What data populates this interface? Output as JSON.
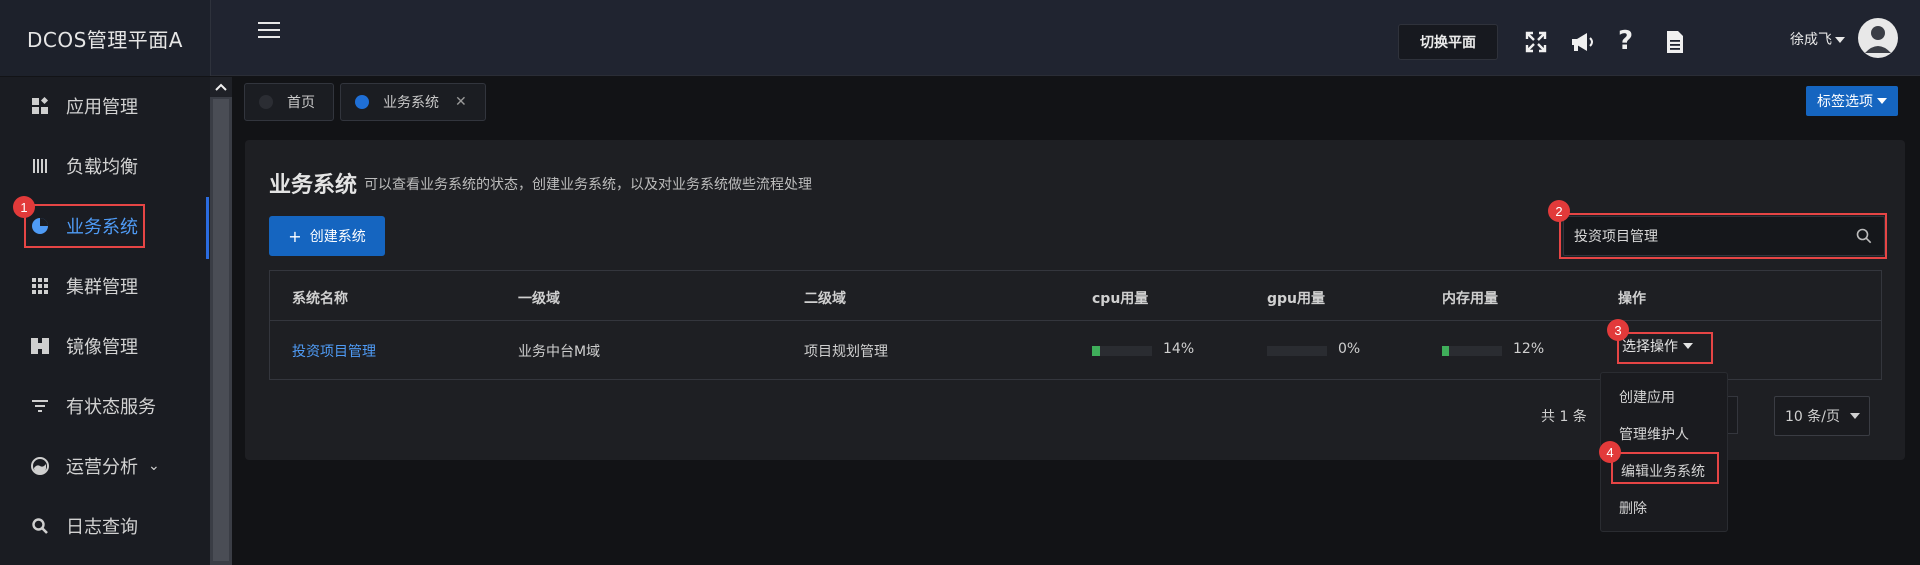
{
  "app": {
    "title": "DCOS管理平面A"
  },
  "header": {
    "switch_plane_label": "切换平面",
    "user_name": "徐成飞",
    "icons": [
      "fullscreen-icon",
      "announcement-icon",
      "help-icon",
      "document-icon"
    ]
  },
  "sidebar": {
    "items": [
      {
        "label": "应用管理",
        "icon": "app-grid-icon"
      },
      {
        "label": "负载均衡",
        "icon": "bars-icon"
      },
      {
        "label": "业务系统",
        "icon": "pie-chart-icon",
        "active": true
      },
      {
        "label": "集群管理",
        "icon": "grid-icon"
      },
      {
        "label": "镜像管理",
        "icon": "image-icon"
      },
      {
        "label": "有状态服务",
        "icon": "filter-icon"
      },
      {
        "label": "运营分析",
        "icon": "gauge-icon"
      },
      {
        "label": "日志查询",
        "icon": "search-icon"
      }
    ]
  },
  "tabs": [
    {
      "label": "首页",
      "dot_color": "#2b2d33"
    },
    {
      "label": "业务系统",
      "dot_color": "#1f6fd6",
      "closable": true
    }
  ],
  "tag_options_label": "标签选项",
  "page": {
    "title": "业务系统",
    "description": "可以查看业务系统的状态，创建业务系统，以及对业务系统做些流程处理",
    "create_button": "创建系统",
    "search_value": "投资项目管理"
  },
  "table": {
    "columns": [
      "系统名称",
      "一级域",
      "二级域",
      "cpu用量",
      "gpu用量",
      "内存用量",
      "操作"
    ],
    "rows": [
      {
        "name": "投资项目管理",
        "domain1": "业务中台M域",
        "domain2": "项目规划管理",
        "cpu": "14%",
        "cpu_value": 0.14,
        "gpu": "0%",
        "gpu_value": 0.0,
        "mem": "12%",
        "mem_value": 0.12,
        "action_label": "选择操作"
      }
    ]
  },
  "dropdown": {
    "items": [
      "创建应用",
      "管理维护人",
      "编辑业务系统",
      "删除"
    ]
  },
  "pager": {
    "total": "共 1 条",
    "page_size": "10 条/页"
  },
  "annotations": [
    "1",
    "2",
    "3",
    "4"
  ],
  "colors": {
    "accent": "#1565c0",
    "link": "#4f9bf5",
    "annotation": "#e64545",
    "usage_bar": "#3fae5a"
  }
}
